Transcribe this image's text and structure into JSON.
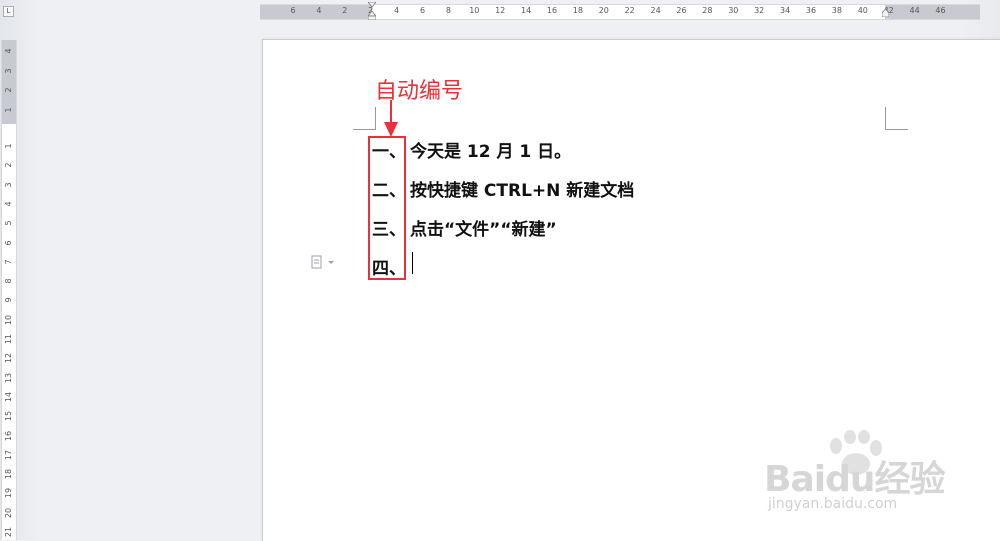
{
  "ruler": {
    "top_ticks": [
      "6",
      "4",
      "2",
      "2",
      "4",
      "6",
      "8",
      "10",
      "12",
      "14",
      "16",
      "18",
      "20",
      "22",
      "24",
      "26",
      "28",
      "30",
      "32",
      "34",
      "36",
      "38",
      "40",
      "42",
      "44",
      "46"
    ],
    "left_ticks_margin": [
      "4",
      "3",
      "2",
      "1"
    ],
    "left_ticks_body": [
      "1",
      "2",
      "3",
      "4",
      "5",
      "6",
      "7",
      "8",
      "9",
      "10",
      "11",
      "12",
      "13",
      "14",
      "15",
      "16",
      "17",
      "18",
      "19",
      "20",
      "21"
    ],
    "corner_tab_symbol": "L"
  },
  "document": {
    "lines": [
      {
        "number": "一、",
        "text": "今天是 12 月 1 日。"
      },
      {
        "number": "二、",
        "text": "按快捷键 CTRL+N 新建文档"
      },
      {
        "number": "三、",
        "text": "点击“文件”“新建”"
      },
      {
        "number": "四、",
        "text": ""
      }
    ]
  },
  "annotation": {
    "label": "自动编号",
    "color": "#e8313b"
  },
  "paste_options": {
    "icon": "paste-options-icon"
  },
  "watermark": {
    "main": "Baidu经验",
    "sub": "jingyan.baidu.com"
  }
}
